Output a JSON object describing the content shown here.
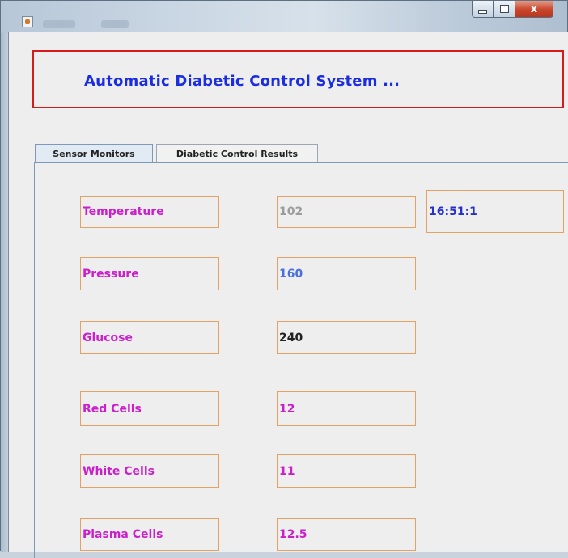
{
  "window": {
    "controls": {
      "minimize_icon": "minimize-icon",
      "maximize_icon": "maximize-icon",
      "close_glyph": "x"
    }
  },
  "header": {
    "title": "Automatic Diabetic Control System ..."
  },
  "tabs": [
    {
      "label": "Sensor Monitors",
      "active": true
    },
    {
      "label": "Diabetic Control Results",
      "active": false
    }
  ],
  "sensors": [
    {
      "label": "Temperature",
      "value": "102"
    },
    {
      "label": "Pressure",
      "value": "160"
    },
    {
      "label": "Glucose",
      "value": "240"
    },
    {
      "label": "Red Cells",
      "value": "12"
    },
    {
      "label": "White Cells",
      "value": "11"
    },
    {
      "label": "Plasma Cells",
      "value": "12.5"
    }
  ],
  "clock": "16:51:1",
  "colors": {
    "title_text": "#1a2de0",
    "header_border": "#d51b1b",
    "label_text": "#cc1fcc",
    "field_border": "#e3a264"
  }
}
